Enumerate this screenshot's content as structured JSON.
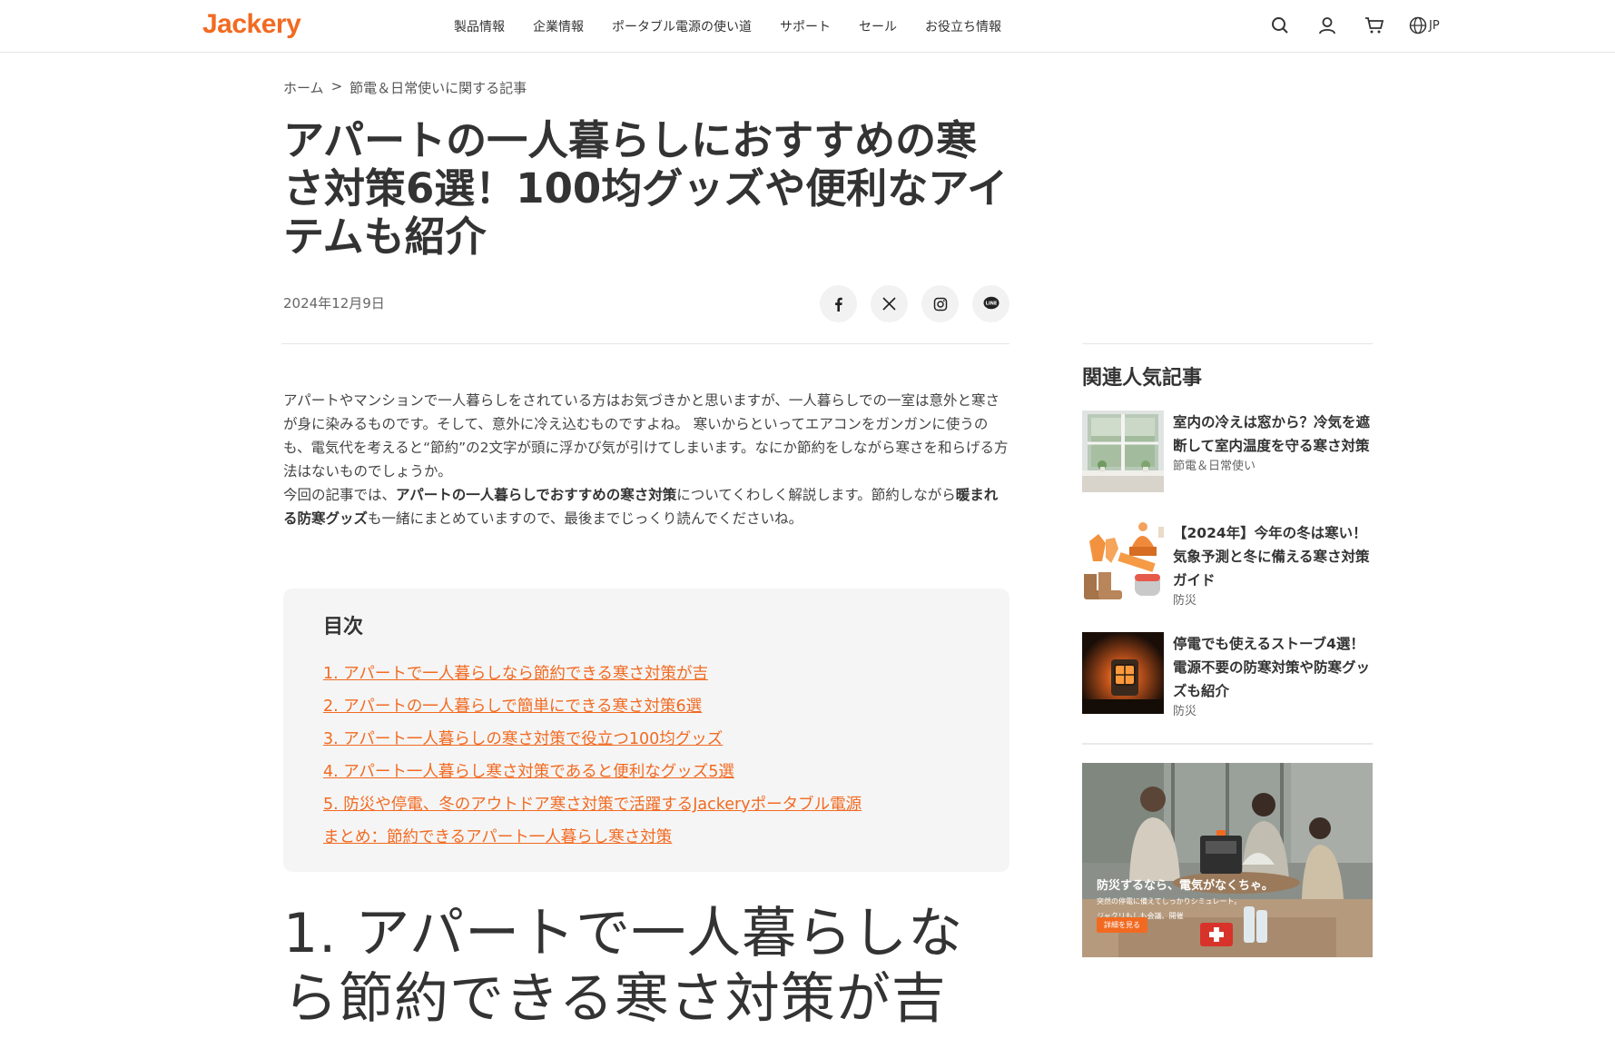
{
  "header": {
    "logo": "Jackery",
    "nav": [
      "製品情報",
      "企業情報",
      "ポータブル電源の使い道",
      "サポート",
      "セール",
      "お役立ち情報"
    ],
    "icons": [
      "search-icon",
      "user-icon",
      "cart-icon",
      "globe-icon"
    ],
    "lang": "JP"
  },
  "breadcrumb": {
    "home": "ホーム",
    "separator": ">",
    "category": "節電＆日常使いに関する記事"
  },
  "article": {
    "title": "アパートの一人暮らしにおすすめの寒さ対策6選！100均グッズや便利なアイテムも紹介",
    "date": "2024年12月9日",
    "share": [
      "facebook-icon",
      "x-icon",
      "instagram-icon",
      "line-icon"
    ],
    "intro": {
      "p1": "アパートやマンションで一人暮らしをされている方はお気づきかと思いますが、一人暮らしでの一室は意外と寒さが身に染みるものです。そして、意外に冷え込むものですよね。 寒いからといってエアコンをガンガンに使うのも、電気代を考えると“節約”の2文字が頭に浮かび気が引けてしまいます。なにか節約をしながら寒さを和らげる方法はないものでしょうか。",
      "p2_a": "今回の記事では、",
      "p2_b": "アパートの一人暮らしでおすすめの寒さ対策",
      "p2_c": "についてくわしく解説します。節約しながら",
      "p2_d": "暖まれる防寒グッズ",
      "p2_e": "も一緒にまとめていますので、最後までじっくり読んでくださいね。"
    },
    "toc": {
      "title": "目次",
      "items": [
        "1.  アパートで一人暮らしなら節約できる寒さ対策が吉",
        "2.  アパートの一人暮らしで簡単にできる寒さ対策6選",
        "3.  アパート一人暮らしの寒さ対策で役立つ100均グッズ",
        "4.  アパート一人暮らし寒さ対策であると便利なグッズ5選",
        "5.  防災や停電、冬のアウトドア寒さ対策で活躍するJackeryポータブル電源",
        "まとめ：節約できるアパート一人暮らし寒さ対策"
      ]
    },
    "section1_title": "1.  アパートで一人暮らしなら節約できる寒さ対策が吉"
  },
  "sidebar": {
    "title": "関連人気記事",
    "items": [
      {
        "title": "室内の冷えは窓から？冷気を遮断して室内温度を守る寒さ対策",
        "category": "節電＆日常使い"
      },
      {
        "title": "【2024年】今年の冬は寒い！気象予測と冬に備える寒さ対策ガイド",
        "category": "防災"
      },
      {
        "title": "停電でも使えるストーブ4選！電源不要の防寒対策や防寒グッズも紹介",
        "category": "防災"
      }
    ],
    "banner": {
      "headline": "防災するなら、電気がなくちゃ。",
      "sub1": "突然の停電に備えてしっかりシミュレート。",
      "sub2": "ジャクリもしも会議、開催",
      "button": "詳細を見る"
    }
  },
  "colors": {
    "accent": "#f26a21",
    "text": "#333333",
    "toc_bg": "#f5f5f5"
  }
}
